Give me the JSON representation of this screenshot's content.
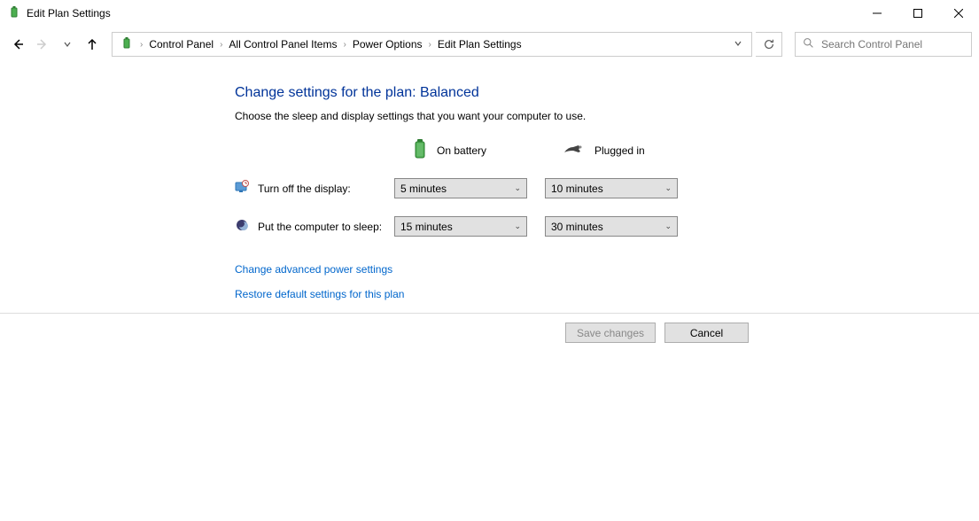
{
  "window": {
    "title": "Edit Plan Settings"
  },
  "breadcrumb": {
    "items": [
      "Control Panel",
      "All Control Panel Items",
      "Power Options",
      "Edit Plan Settings"
    ]
  },
  "search": {
    "placeholder": "Search Control Panel"
  },
  "main": {
    "heading": "Change settings for the plan: Balanced",
    "subtext": "Choose the sleep and display settings that you want your computer to use.",
    "columns": {
      "battery": "On battery",
      "plugged": "Plugged in"
    },
    "settings": {
      "display": {
        "label": "Turn off the display:",
        "battery": "5 minutes",
        "plugged": "10 minutes"
      },
      "sleep": {
        "label": "Put the computer to sleep:",
        "battery": "15 minutes",
        "plugged": "30 minutes"
      }
    },
    "links": {
      "advanced": "Change advanced power settings",
      "restore": "Restore default settings for this plan"
    },
    "buttons": {
      "save": "Save changes",
      "cancel": "Cancel"
    }
  }
}
